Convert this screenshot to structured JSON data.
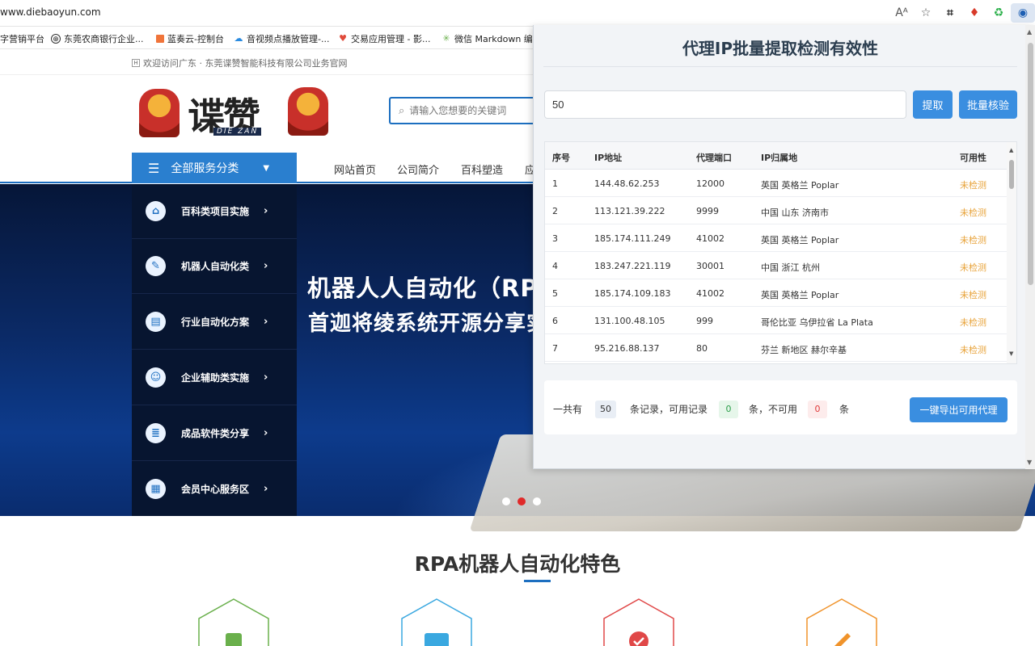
{
  "browser": {
    "url": "www.diebaoyun.com",
    "bookmarks": [
      {
        "label": "字营销平台"
      },
      {
        "label": "东莞农商银行企业..."
      },
      {
        "label": "蓝奏云-控制台"
      },
      {
        "label": "音视频点播放管理-..."
      },
      {
        "label": "交易应用管理 - 影..."
      },
      {
        "label": "微信 Markdown 编..."
      }
    ]
  },
  "site": {
    "welcome": "欢迎访问广东 · 东莞谍赞智能科技有限公司业务官网",
    "logo_text": "谍赞",
    "logo_pinyin": "DIE ZAN",
    "search_placeholder": "请输入您想要的关键词",
    "all_categories": "全部服务分类",
    "nav": [
      "网站首页",
      "公司简介",
      "百科塑造",
      "应"
    ],
    "categories": [
      {
        "label": "百科类项目实施"
      },
      {
        "label": "机器人自动化类"
      },
      {
        "label": "行业自动化方案"
      },
      {
        "label": "企业辅助类实施"
      },
      {
        "label": "成品软件类分享"
      },
      {
        "label": "会员中心服务区"
      }
    ],
    "banner_title": "机器人人自动化（RP",
    "banner_subtitle": "首迦将绫系统开源分享实",
    "features_title": "RPA机器人自动化特色",
    "feature_icon_colors": [
      "#6ab04c",
      "#3aa8e0",
      "#e04848",
      "#f0932b"
    ]
  },
  "popup": {
    "title": "代理IP批量提取检测有效性",
    "count_value": "50",
    "extract_label": "提取",
    "verify_label": "批量核验",
    "columns": [
      "序号",
      "IP地址",
      "代理端口",
      "IP归属地",
      "可用性"
    ],
    "rows": [
      {
        "no": "1",
        "ip": "144.48.62.253",
        "port": "12000",
        "loc": "英国 英格兰 Poplar",
        "status": "未检测"
      },
      {
        "no": "2",
        "ip": "113.121.39.222",
        "port": "9999",
        "loc": "中国 山东 济南市",
        "status": "未检测"
      },
      {
        "no": "3",
        "ip": "185.174.111.249",
        "port": "41002",
        "loc": "英国 英格兰 Poplar",
        "status": "未检测"
      },
      {
        "no": "4",
        "ip": "183.247.221.119",
        "port": "30001",
        "loc": "中国 浙江 杭州",
        "status": "未检测"
      },
      {
        "no": "5",
        "ip": "185.174.109.183",
        "port": "41002",
        "loc": "英国 英格兰 Poplar",
        "status": "未检测"
      },
      {
        "no": "6",
        "ip": "131.100.48.105",
        "port": "999",
        "loc": "哥伦比亚 乌伊拉省 La Plata",
        "status": "未检测"
      },
      {
        "no": "7",
        "ip": "95.216.88.137",
        "port": "80",
        "loc": "芬兰 新地区 赫尔辛基",
        "status": "未检测"
      }
    ],
    "summary": {
      "prefix": "一共有",
      "total": "50",
      "mid1": "条记录，可用记录",
      "ok": "0",
      "mid2": "条，不可用",
      "bad": "0",
      "suffix": "条"
    },
    "export_label": "一键导出可用代理"
  }
}
